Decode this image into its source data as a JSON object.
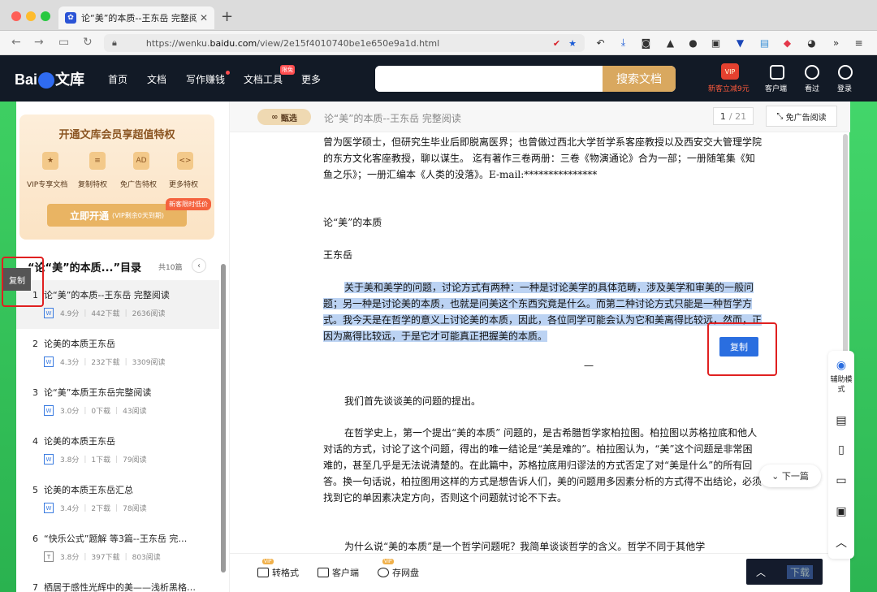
{
  "browser": {
    "tab_title": "论“美”的本质--王东岳 完整阅读 - 百",
    "url_prefix": "https://wenku.",
    "url_host": "baidu.com",
    "url_path": "/view/2e15f4010740be1e650e9a1d.html",
    "new_tab_label": "+"
  },
  "header": {
    "logo_left": "Bai",
    "logo_right": "文库",
    "nav": [
      "首页",
      "文档",
      "写作赚钱",
      "文档工具",
      "更多"
    ],
    "new_badge": "限免",
    "search_placeholder": "",
    "search_button": "搜索文档",
    "promo_gift": "VIP",
    "promo_text": "新客立减9元",
    "icons": [
      "客户端",
      "看过",
      "登录"
    ]
  },
  "sidebar": {
    "vip_title": "开通文库会员享超值特权",
    "perks": [
      {
        "label": "VIP专享文档",
        "icon": "★"
      },
      {
        "label": "复制特权",
        "icon": "≡"
      },
      {
        "label": "免广告特权",
        "icon": "AD"
      },
      {
        "label": "更多特权",
        "icon": "<>"
      }
    ],
    "limited_badge": "新客限时低价",
    "open_button": "立即开通",
    "open_button_sub": "(VIP剩余0天到期)",
    "toc_title": "“论“美”的本质...”目录",
    "toc_count": "共10篇",
    "copy_label": "复制",
    "toc_items": [
      {
        "num": "1",
        "title": "论“美”的本质--王东岳 完整阅读",
        "type": "W",
        "score": "4.9分",
        "downloads": "442下载",
        "reads": "2636阅读"
      },
      {
        "num": "2",
        "title": "论美的本质王东岳",
        "type": "W",
        "score": "4.3分",
        "downloads": "232下载",
        "reads": "3309阅读"
      },
      {
        "num": "3",
        "title": "论“美”本质王东岳完整阅读",
        "type": "W",
        "score": "3.0分",
        "downloads": "0下载",
        "reads": "43阅读"
      },
      {
        "num": "4",
        "title": "论美的本质王东岳",
        "type": "W",
        "score": "3.8分",
        "downloads": "1下载",
        "reads": "79阅读"
      },
      {
        "num": "5",
        "title": "论美的本质王东岳汇总",
        "type": "W",
        "score": "3.4分",
        "downloads": "2下载",
        "reads": "78阅读"
      },
      {
        "num": "6",
        "title": "“快乐公式”题解 等3篇--王东岳 完…",
        "type": "T",
        "score": "3.8分",
        "downloads": "397下载",
        "reads": "803阅读"
      },
      {
        "num": "7",
        "title": "栖居于感性光辉中的美——浅析黑格…",
        "type": "",
        "score": "",
        "downloads": "",
        "reads": ""
      }
    ]
  },
  "doc": {
    "select_badge": "甄选",
    "title": "论“美”的本质--王东岳 完整阅读",
    "page_current": "1",
    "page_total": "/ 21",
    "noads_label": "免广告阅读",
    "bio": "曾为医学硕士，但研究生毕业后即脱离医界；也曾做过西北大学哲学系客座教授以及西安交大管理学院的东方文化客座教授，聊以谋生。 迄有著作三卷两册：三卷《物演通论》合为一部；一册随笔集《知鱼之乐》；一册汇编本《人类的没落》。E-mail:***************",
    "heading": "论“美”的本质",
    "author": "王东岳",
    "highlighted_para": "关于美和美学的问题，讨论方式有两种：一种是讨论美学的具体范畴，涉及美学和审美的一般问题；另一种是讨论美的本质，也就是问美这个东西究竟是什么。而第二种讨论方式只能是一种哲学方式。我今天是在哲学的意义上讨论美的本质，因此，各位同学可能会认为它和美离得比较远，然而，正因为离得比较远，于是它才可能真正把握美的本质。",
    "section_mark": "一",
    "para2": "我们首先谈谈美的问题的提出。",
    "para3": "在哲学史上，第一个提出“美的本质” 问题的，是古希腊哲学家柏拉图。柏拉图以苏格拉底和他人对话的方式，讨论了这个问题，得出的唯一结论是“美是难的”。柏拉图认为，“美”这个问题是非常困难的，甚至几乎是无法说清楚的。在此篇中，苏格拉底用归谬法的方式否定了对“美是什么”的所有回答。换一句话说，柏拉图用这样的方式是想告诉人们，美的问题用多因素分析的方式得不出结论，必须找到它的单因素决定方向，否则这个问题就讨论不下去。",
    "para4": "为什么说“美的本质”是一个哲学问题呢？我简单谈谈哲学的含义。哲学不同于其他学",
    "copy_button": "复制",
    "next_button": "下一篇",
    "bottom": {
      "convert": "转格式",
      "client": "客户端",
      "save": "存网盘",
      "vip_tag": "VIP",
      "download": "下载",
      "up_arrow": "︿"
    }
  },
  "tools": {
    "assist_label": "辅助模式"
  }
}
